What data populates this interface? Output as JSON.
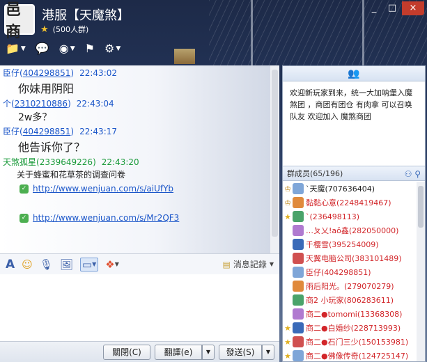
{
  "window": {
    "title": "港服【天魔煞】",
    "member_count": "(500人群)",
    "avatar_text": "邑商",
    "controls": {
      "min": "_",
      "max": "□",
      "close": "×"
    }
  },
  "toolbar": {
    "icons": [
      "folder-icon",
      "add-chat-icon",
      "video-icon",
      "broadcast-icon",
      "settings-icon"
    ]
  },
  "messages": [
    {
      "sender": "臣仔",
      "id": "404298851",
      "time": "22:43:02",
      "color": "blue",
      "body": "你妹用阴阳",
      "size": "big"
    },
    {
      "sender": "个",
      "id": "2310210886",
      "time": "22:43:04",
      "color": "blue",
      "body": "2w多？",
      "size": "big"
    },
    {
      "sender": "臣仔",
      "id": "404298851",
      "time": "22:43:17",
      "color": "blue",
      "body": "他告诉你了？",
      "size": "big"
    },
    {
      "sender": "天煞孤星",
      "id": "2339649226",
      "time": "22:43:20",
      "color": "green",
      "body": "关于蜂蜜和花草茶的调查问卷",
      "size": "small",
      "links": [
        "http://www.wenjuan.com/s/aiUfYb",
        "http://www.wenjuan.com/s/Mr2QF3"
      ]
    }
  ],
  "input_toolbar": {
    "history_label": "消息記錄"
  },
  "buttons": {
    "close": "關閉(C)",
    "translate": "翻譯(e)",
    "send": "發送(S)"
  },
  "announcement": {
    "text": "欢迎新玩家到来，统一大加呐堡入魔煞团 ，商团有团仓 有肉拿 可以召唤队友 欢迎加入 魔煞商团"
  },
  "members": {
    "header": "群成员(65/196)",
    "list": [
      {
        "rank": "owner",
        "name": "`天魔(707636404)",
        "color": "black"
      },
      {
        "rank": "owner",
        "name": "黏黏心意(2248419467)",
        "color": "red"
      },
      {
        "rank": "star",
        "name": "`(236498113)",
        "color": "red"
      },
      {
        "rank": "",
        "name": "…ㄆ乂!aǒ鑫(282050000)",
        "color": "red"
      },
      {
        "rank": "",
        "name": "千樱雪(395254009)",
        "color": "red"
      },
      {
        "rank": "",
        "name": "天翼电脑公司(383101489)",
        "color": "red"
      },
      {
        "rank": "",
        "name": "臣仔(404298851)",
        "color": "red"
      },
      {
        "rank": "",
        "name": "雨后阳光。(279070279)",
        "color": "red"
      },
      {
        "rank": "",
        "name": "商2 小玩家(806283611)",
        "color": "red"
      },
      {
        "rank": "",
        "name": "商二●tomomi(13368308)",
        "color": "red"
      },
      {
        "rank": "star",
        "name": "商二●白婚纱(228713993)",
        "color": "red"
      },
      {
        "rank": "star",
        "name": "商二●石门三少(150153981)",
        "color": "red"
      },
      {
        "rank": "star",
        "name": "商二●佛像传奇(124725147)",
        "color": "red"
      }
    ]
  },
  "colors": {
    "blue": "#1b56c9",
    "green": "#1a9a3a",
    "red": "#d2262a",
    "close": "#c33c2c"
  }
}
